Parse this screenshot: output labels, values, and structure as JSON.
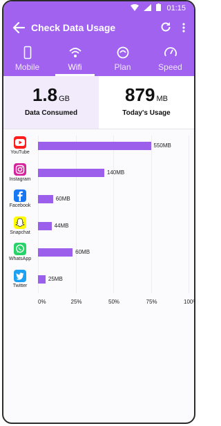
{
  "status": {
    "time": "01:15"
  },
  "header": {
    "title": "Check Data Usage"
  },
  "tabs": [
    {
      "label": "Mobile",
      "icon": "phone-icon"
    },
    {
      "label": "Wifi",
      "icon": "wifi-icon"
    },
    {
      "label": "Plan",
      "icon": "plan-icon"
    },
    {
      "label": "Speed",
      "icon": "speedometer-icon"
    }
  ],
  "summary": {
    "consumed": {
      "value": "1.8",
      "unit": "GB",
      "label": "Data Consumed"
    },
    "today": {
      "value": "879",
      "unit": "MB",
      "label": "Today's Usage"
    }
  },
  "colors": {
    "accent": "#a062ef",
    "bar": "#9c5fec"
  },
  "chart_data": {
    "type": "bar",
    "orientation": "horizontal",
    "categories": [
      "YouTube",
      "Instagram",
      "Facebook",
      "Snapchat",
      "WhatsApp",
      "Twitter"
    ],
    "values": [
      75,
      44,
      10,
      9,
      23,
      5
    ],
    "data_labels": [
      "550MB",
      "140MB",
      "60MB",
      "44MB",
      "60MB",
      "25MB"
    ],
    "xticks": [
      "0%",
      "25%",
      "50%",
      "75%",
      "100%"
    ],
    "xlim": [
      0,
      100
    ]
  }
}
